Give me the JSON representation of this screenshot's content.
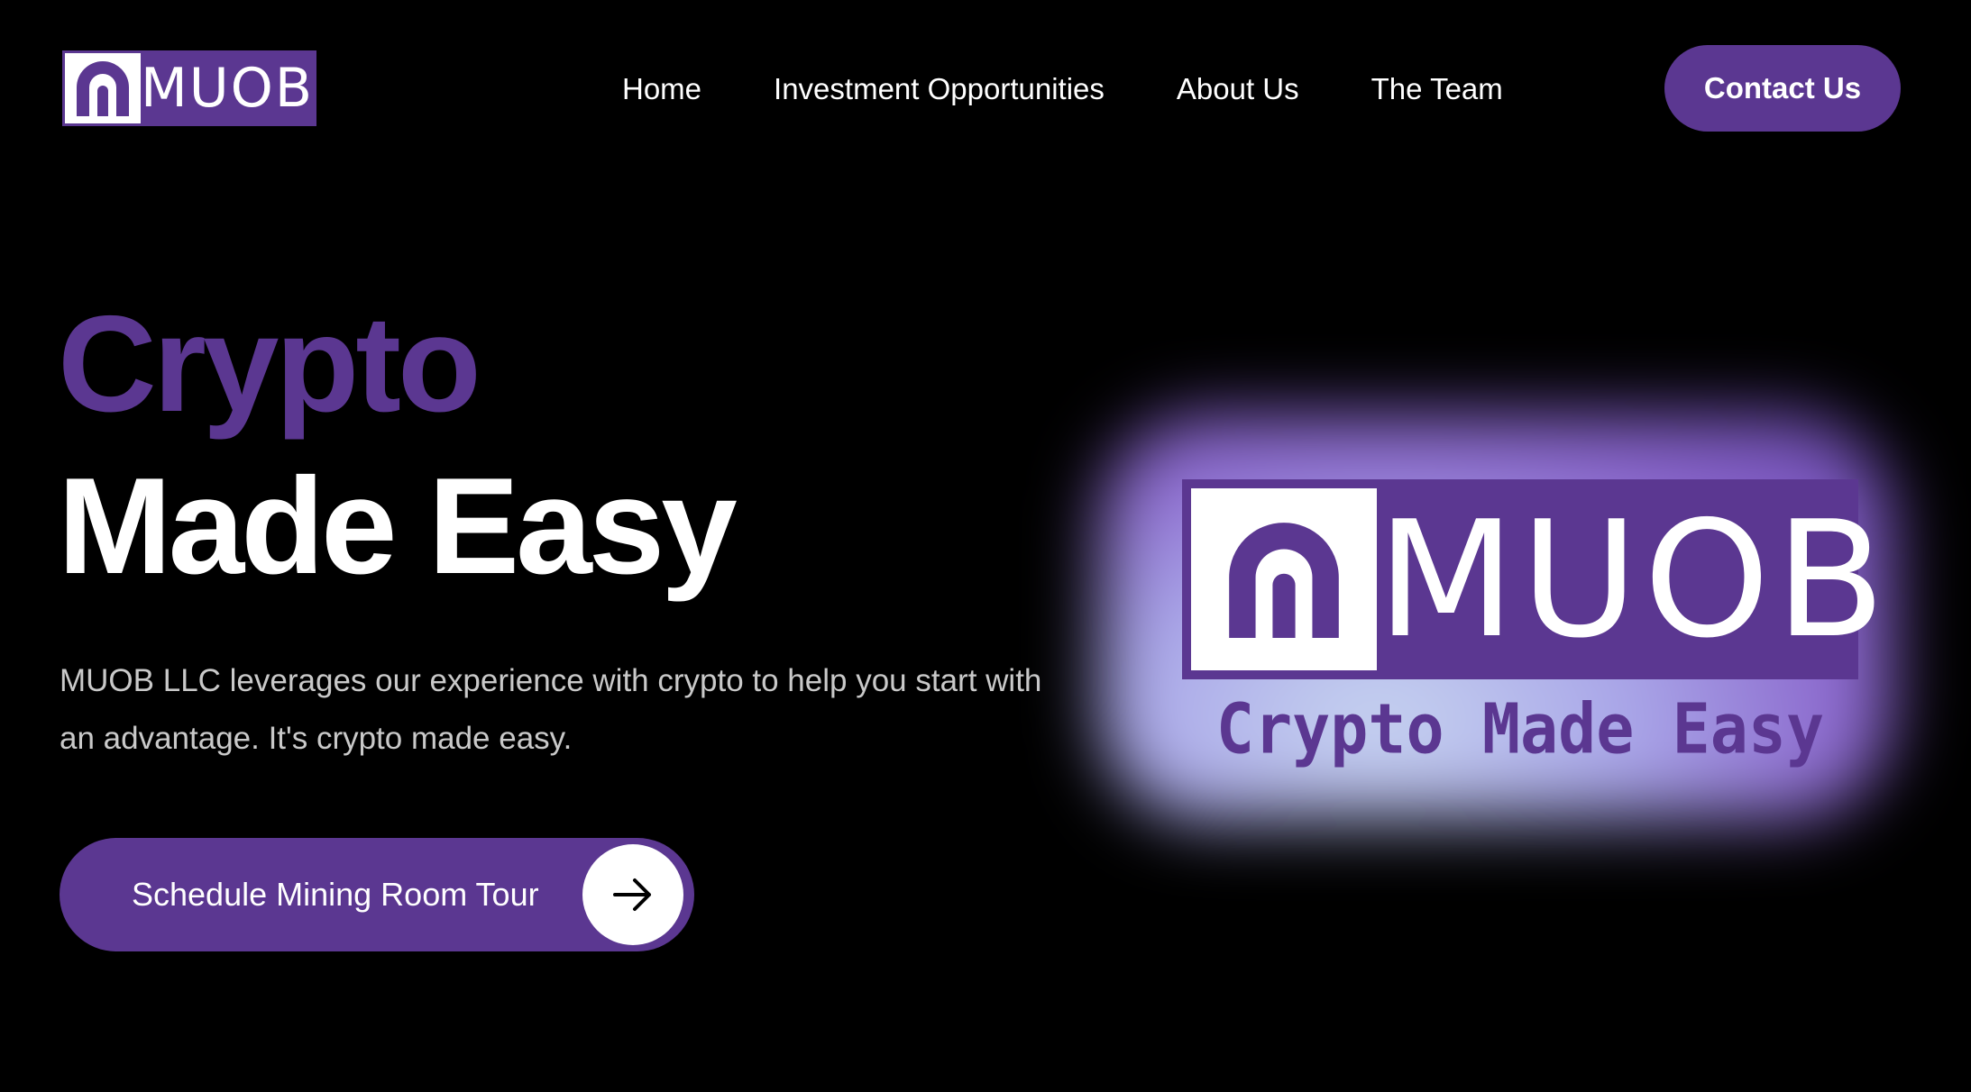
{
  "brand": {
    "logo_text": "MUOB",
    "purple": "#5b3791"
  },
  "nav": {
    "items": [
      {
        "label": "Home"
      },
      {
        "label": "Investment Opportunities"
      },
      {
        "label": "About Us"
      },
      {
        "label": "The Team"
      }
    ],
    "contact_label": "Contact Us"
  },
  "hero": {
    "title_line1": "Crypto",
    "title_line2": "Made Easy",
    "description": "MUOB LLC leverages our experience with crypto to help you start with an advantage. It's crypto made easy.",
    "cta_label": "Schedule Mining Room Tour",
    "cta_icon": "arrow-right-icon"
  },
  "hero_image": {
    "logo_text": "MUOB",
    "tagline": "Crypto Made Easy"
  }
}
